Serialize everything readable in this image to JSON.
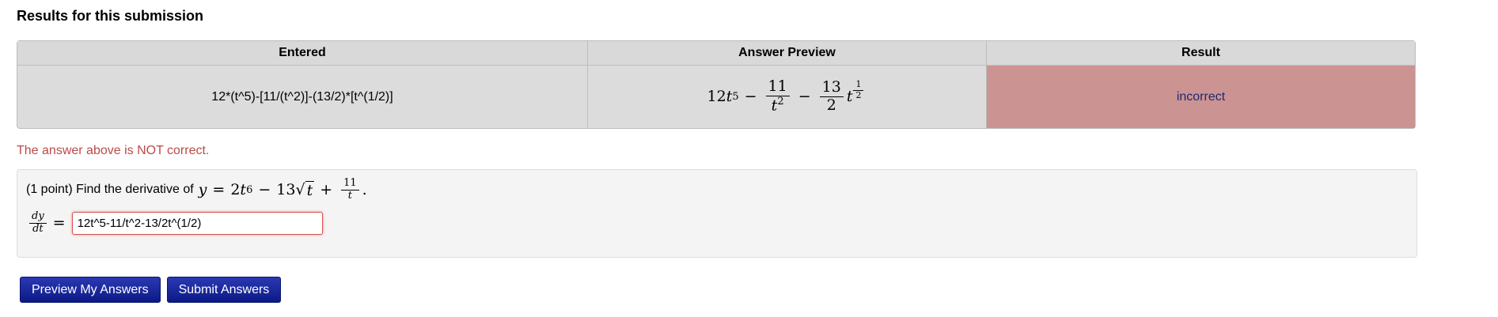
{
  "title": "Results for this submission",
  "table": {
    "headers": [
      "Entered",
      "Answer Preview",
      "Result"
    ],
    "row": {
      "entered": "12*(t^5)-[11/(t^2)]-(13/2)*[t^(1/2)]",
      "preview": {
        "coef1": "12",
        "var": "t",
        "exp1": "5",
        "minus": "−",
        "frac1_num": "11",
        "frac1_den_var": "t",
        "frac1_den_exp": "2",
        "frac2_num": "13",
        "frac2_den": "2",
        "exp_num": "1",
        "exp_den": "2"
      },
      "result": "incorrect"
    }
  },
  "message": "The answer above is NOT correct.",
  "problem": {
    "prefix": "(1 point) Find the derivative of",
    "y": "y",
    "eq": "=",
    "c1": "2",
    "t": "t",
    "e1": "6",
    "minus": "−",
    "c2": "13",
    "sqrt": "√",
    "plus": "+",
    "fnum": "11",
    "fden": "t",
    "period": ".",
    "lhs_num": "dy",
    "lhs_den": "dt",
    "answer_value": "12t^5-11/t^2-13/2t^(1/2)"
  },
  "buttons": {
    "preview": "Preview My Answers",
    "submit": "Submit Answers"
  },
  "colors": {
    "incorrect_cell": "#cc9393",
    "error_text": "#b94a48",
    "button": "#15259c"
  }
}
